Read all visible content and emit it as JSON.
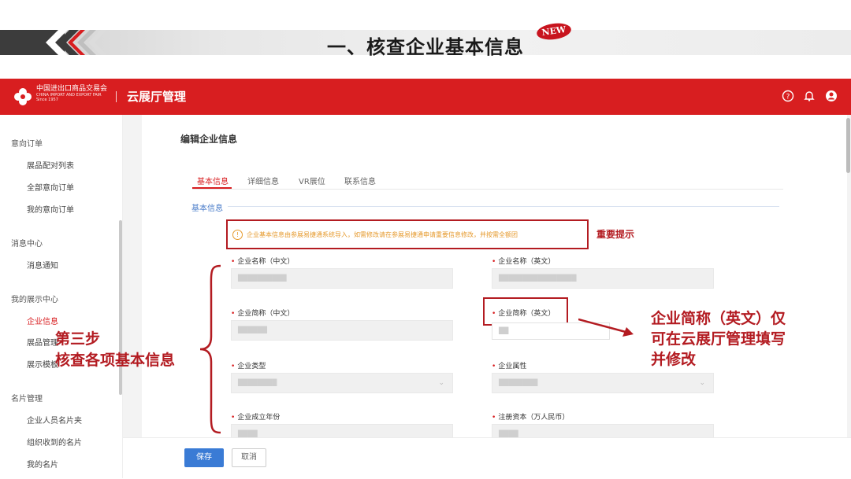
{
  "slide": {
    "title": "一、核查企业基本信息",
    "badge": "NEW"
  },
  "header": {
    "logo_text_cn": "中国进出口商品交易会",
    "logo_text_en": "CHINA IMPORT AND EXPORT FAIR",
    "logo_text_since": "Since 1957",
    "app_name": "云展厅管理",
    "icons": [
      "help-icon",
      "bell-icon",
      "user-icon"
    ]
  },
  "sidebar": {
    "groups": [
      {
        "label": "意向订单",
        "items": [
          {
            "label": "展品配对列表"
          },
          {
            "label": "全部意向订单"
          },
          {
            "label": "我的意向订单"
          }
        ]
      },
      {
        "label": "消息中心",
        "items": [
          {
            "label": "消息通知"
          }
        ]
      },
      {
        "label": "我的展示中心",
        "items": [
          {
            "label": "企业信息",
            "active": true
          },
          {
            "label": "展品管理"
          },
          {
            "label": "展示模板"
          }
        ]
      },
      {
        "label": "名片管理",
        "items": [
          {
            "label": "企业人员名片夹"
          },
          {
            "label": "组织收到的名片"
          },
          {
            "label": "我的名片"
          }
        ]
      }
    ]
  },
  "form": {
    "title": "编辑企业信息",
    "tabs": [
      {
        "label": "基本信息",
        "active": true
      },
      {
        "label": "详细信息"
      },
      {
        "label": "VR展位"
      },
      {
        "label": "联系信息"
      }
    ],
    "section_label": "基本信息",
    "notice": "企业基本信息由参展易捷通系统导入，如需修改请在参展易捷通申请重要信息修改，并按需全额团",
    "notice_label": "重要提示",
    "fields": [
      {
        "label": "企业名称（中文）",
        "value": "██████████"
      },
      {
        "label": "企业名称（英文）",
        "value": "████████████████"
      },
      {
        "label": "企业简称（中文）",
        "value": "██████"
      },
      {
        "label": "企业简称（英文）",
        "value": "██"
      },
      {
        "label": "企业类型",
        "value": "████████"
      },
      {
        "label": "企业属性",
        "value": "████████"
      },
      {
        "label": "企业成立年份",
        "value": "████"
      },
      {
        "label": "注册资本（万人民币）",
        "value": "████"
      }
    ],
    "save_label": "保存",
    "cancel_label": "取消"
  },
  "annotations": {
    "step_line1": "第三步",
    "step_line2": "核查各项基本信息",
    "callout_line1": "企业简称（英文）仅",
    "callout_line2": "可在云展厅管理填写",
    "callout_line3": "并修改",
    "accent_color": "#b31b21"
  }
}
